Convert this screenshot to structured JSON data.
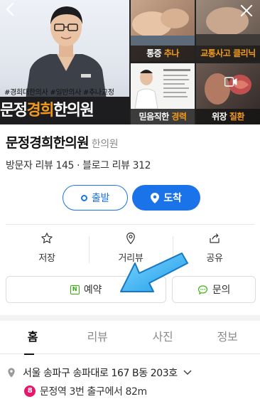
{
  "photos": {
    "hashtags": "#경희대한의사 #일반의사 #추나교정",
    "clinic_banner_pre": "문정",
    "clinic_banner_hl": "경희",
    "clinic_banner_post": "한의원",
    "tiles": [
      {
        "pre": "통증 ",
        "hl": "추나",
        "post": ""
      },
      {
        "pre": "",
        "hl": "교통사고 클리닉",
        "post": ""
      },
      {
        "pre": "믿음직한 ",
        "hl": "경력",
        "post": ""
      },
      {
        "pre": "위장 ",
        "hl": "질환",
        "post": ""
      }
    ],
    "icons": {
      "close": "close-icon",
      "back": "back-icon",
      "video": "video-icon"
    }
  },
  "place": {
    "name": "문정경희한의원",
    "category": "한의원",
    "reviews_text": "방문자 리뷰 145 · 블로그 리뷰 312"
  },
  "route": {
    "depart_label": "출발",
    "arrive_label": "도착",
    "accent_color": "#1a73e8"
  },
  "actions": {
    "save_label": "저장",
    "distance_label": "거리뷰",
    "share_label": "공유",
    "reserve_label": "예약",
    "inquiry_label": "문의"
  },
  "tabs": [
    {
      "label": "홈",
      "active": true
    },
    {
      "label": "리뷰",
      "active": false
    },
    {
      "label": "사진",
      "active": false
    },
    {
      "label": "정보",
      "active": false
    }
  ],
  "info": {
    "address": "서울 송파구 송파대로 167 B동 203호",
    "subway_line": "8",
    "subway_line_color": "#e6186c",
    "subway_text": "문정역 3번 출구에서 82m"
  }
}
